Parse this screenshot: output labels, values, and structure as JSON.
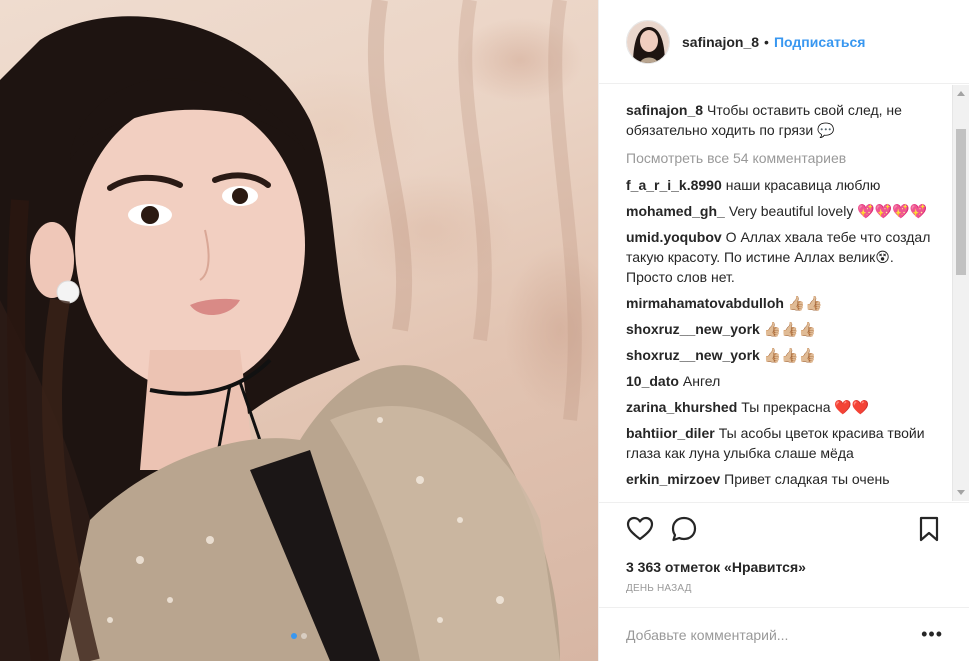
{
  "post": {
    "username": "safinajon_8",
    "separator": "•",
    "follow_label": "Подписаться"
  },
  "caption": {
    "username": "safinajon_8",
    "text": "Чтобы оставить свой след, не обязательно ходить по грязи 💬"
  },
  "view_all_comments": "Посмотреть все 54 комментариев",
  "comments": [
    {
      "username": "f_a_r_i_k.8990",
      "text": "наши красавица люблю"
    },
    {
      "username": "mohamed_gh_",
      "text": "Very beautiful lovely 💖💖💖💖"
    },
    {
      "username": "umid.yoqubov",
      "text": "О Аллах хвала тебе что создал такую красоту. По истине Аллах велик😵. Просто слов нет."
    },
    {
      "username": "mirmahamatovabdulloh",
      "text": "👍🏼👍🏼"
    },
    {
      "username": "shoxruz__new_york",
      "text": "👍🏼👍🏼👍🏼"
    },
    {
      "username": "shoxruz__new_york",
      "text": "👍🏼👍🏼👍🏼"
    },
    {
      "username": "10_dato",
      "text": "Ангел"
    },
    {
      "username": "zarina_khurshed",
      "text": "Ты прекрасна ❤️❤️"
    },
    {
      "username": "bahtiior_diler",
      "text": "Ты асобы цветок красива твойи глаза как луна улыбка слаше мёда"
    },
    {
      "username": "erkin_mirzoev",
      "text": "Привет сладкая ты очень"
    }
  ],
  "actions": {
    "like_icon": "heart-outline-icon",
    "comment_icon": "speech-bubble-icon",
    "save_icon": "bookmark-icon"
  },
  "likes_text": "3 363 отметок «Нравится»",
  "time_text": "ДЕНЬ НАЗАД",
  "add_comment": {
    "placeholder": "Добавьте комментарий...",
    "more_label": "•••"
  },
  "colors": {
    "link_blue": "#3897f0",
    "text": "#262626",
    "muted": "#999999"
  }
}
